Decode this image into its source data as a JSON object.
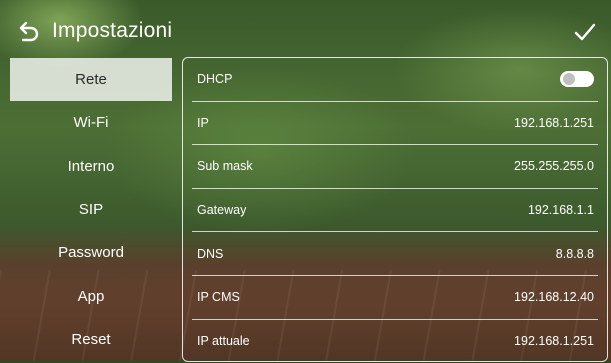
{
  "header": {
    "title": "Impostazioni",
    "back_icon": "back-arrow-icon",
    "confirm_icon": "checkmark-icon"
  },
  "sidebar": {
    "items": [
      {
        "label": "Rete",
        "active": true
      },
      {
        "label": "Wi-Fi",
        "active": false
      },
      {
        "label": "Interno",
        "active": false
      },
      {
        "label": "SIP",
        "active": false
      },
      {
        "label": "Password",
        "active": false
      },
      {
        "label": "App",
        "active": false
      },
      {
        "label": "Reset",
        "active": false
      }
    ]
  },
  "network": {
    "dhcp": {
      "label": "DHCP",
      "enabled": false
    },
    "rows": [
      {
        "label": "IP",
        "value": "192.168.1.251"
      },
      {
        "label": "Sub mask",
        "value": "255.255.255.0"
      },
      {
        "label": "Gateway",
        "value": "192.168.1.1"
      },
      {
        "label": "DNS",
        "value": "8.8.8.8"
      },
      {
        "label": "IP CMS",
        "value": "192.168.12.40"
      },
      {
        "label": "IP attuale",
        "value": "192.168.1.251"
      }
    ]
  },
  "colors": {
    "active_tab_bg": "#e6e6e6",
    "text": "#ffffff",
    "toggle_track": "#ffffff",
    "toggle_knob": "#bfbfbf"
  }
}
